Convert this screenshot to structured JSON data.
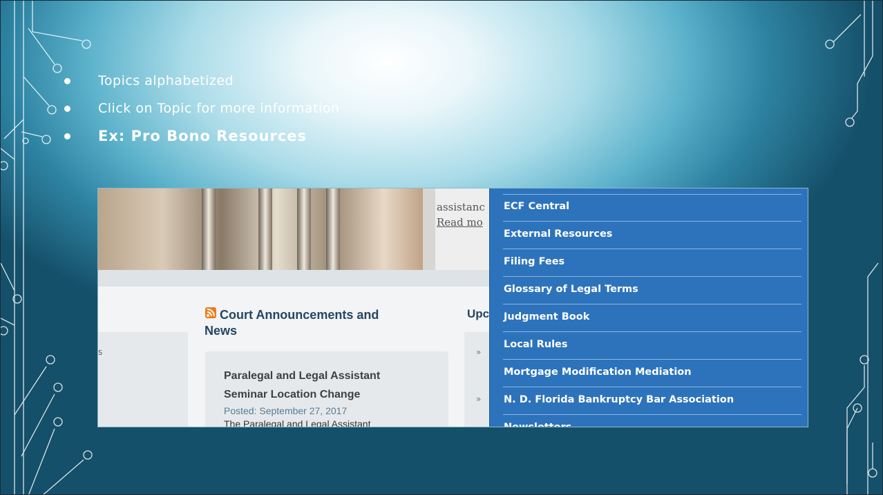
{
  "bullets": [
    "Topics alphabetized",
    "Click on Topic for more information",
    "Ex:  Pro Bono Resources"
  ],
  "screenshot": {
    "intro_lines": [
      "assistanc",
      "Read mo"
    ],
    "left_fragment": "s",
    "announcements": {
      "title": "Court Announcements and News",
      "card": {
        "title": "Paralegal and Legal Assistant Seminar Location Change",
        "posted": "Posted: September 27, 2017",
        "body": "The Paralegal and Legal Assistant"
      }
    },
    "upcoming_fragment": "Upc",
    "chevron": "»",
    "menu_items": [
      "ECF Central",
      "External Resources",
      "Filing Fees",
      "Glossary of Legal Terms",
      "Judgment Book",
      "Local Rules",
      "Mortgage Modification Mediation",
      "N. D. Florida Bankruptcy Bar Association"
    ],
    "menu_partial": "Newsletters"
  }
}
